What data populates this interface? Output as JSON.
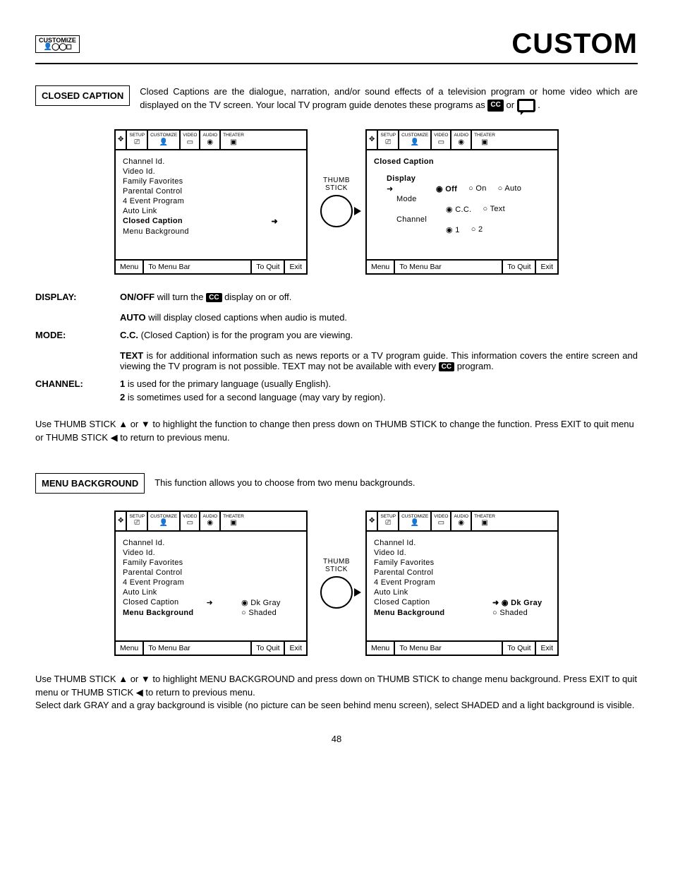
{
  "header": {
    "customize_label": "CUSTOMIZE",
    "page_title": "CUSTOM"
  },
  "section1": {
    "label": "CLOSED CAPTION",
    "intro_a": "Closed Captions are the dialogue, narration, and/or sound effects of a television program or home video which are displayed on the TV screen.  Your local TV program guide denotes these programs as ",
    "intro_b": " or ",
    "intro_c": "."
  },
  "tabs": [
    "SETUP",
    "CUSTOMIZE",
    "VIDEO",
    "AUDIO",
    "THEATER"
  ],
  "customize_menu_items": [
    "Channel Id.",
    "Video Id.",
    "Family Favorites",
    "Parental Control",
    "4 Event Program",
    "Auto Link",
    "Closed Caption",
    "Menu Background"
  ],
  "osd_footer": {
    "menu": "Menu",
    "bar": "To Menu Bar",
    "quit": "To Quit",
    "exit": "Exit"
  },
  "thumb": {
    "line1": "THUMB",
    "line2": "STICK"
  },
  "cc_detail": {
    "title": "Closed Caption",
    "display_label": "Display",
    "display_opts": [
      "Off",
      "On",
      "Auto"
    ],
    "mode_label": "Mode",
    "mode_opts": [
      "C.C.",
      "Text"
    ],
    "channel_label": "Channel",
    "channel_opts": [
      "1",
      "2"
    ]
  },
  "defs": {
    "display_label": "DISPLAY:",
    "display_onoff": "ON/OFF",
    "display_onoff_tail": " will turn the ",
    "display_onoff_tail2": " display on or off.",
    "display_auto": "AUTO",
    "display_auto_tail": " will display closed captions when audio is muted.",
    "mode_label": "MODE:",
    "mode_cc": "C.C.",
    "mode_cc_tail": " (Closed Caption) is for the program you are viewing.",
    "mode_text": "TEXT",
    "mode_text_tail": " is for additional information such as news reports or a TV program guide.  This information covers the entire screen and viewing the TV program is not possible.  TEXT may not be available with every ",
    "mode_text_tail2": " program.",
    "channel_label": "CHANNEL:",
    "channel_1": "1",
    "channel_1_tail": " is used for the primary language (usually English).",
    "channel_2": "2",
    "channel_2_tail": " is sometimes used for a second language (may vary by region)."
  },
  "cc_note": "Use THUMB STICK ▲ or ▼ to highlight the function to change then press down on THUMB STICK to change the function. Press EXIT to quit menu or THUMB STICK ◀ to return to previous menu.",
  "section2": {
    "label": "MENU BACKGROUND",
    "intro": "This function allows you to choose from two menu backgrounds."
  },
  "mb_opts": {
    "dk": "Dk Gray",
    "shaded": "Shaded"
  },
  "mb_note": "Use THUMB STICK ▲ or ▼ to highlight MENU BACKGROUND and press down on THUMB STICK to change menu background. Press EXIT to quit menu or THUMB STICK ◀ to return to previous menu.\nSelect dark GRAY and a gray background is visible (no picture can be seen behind menu screen), select SHADED and a light background is visible.",
  "page_number": "48",
  "cc_badge": "CC"
}
